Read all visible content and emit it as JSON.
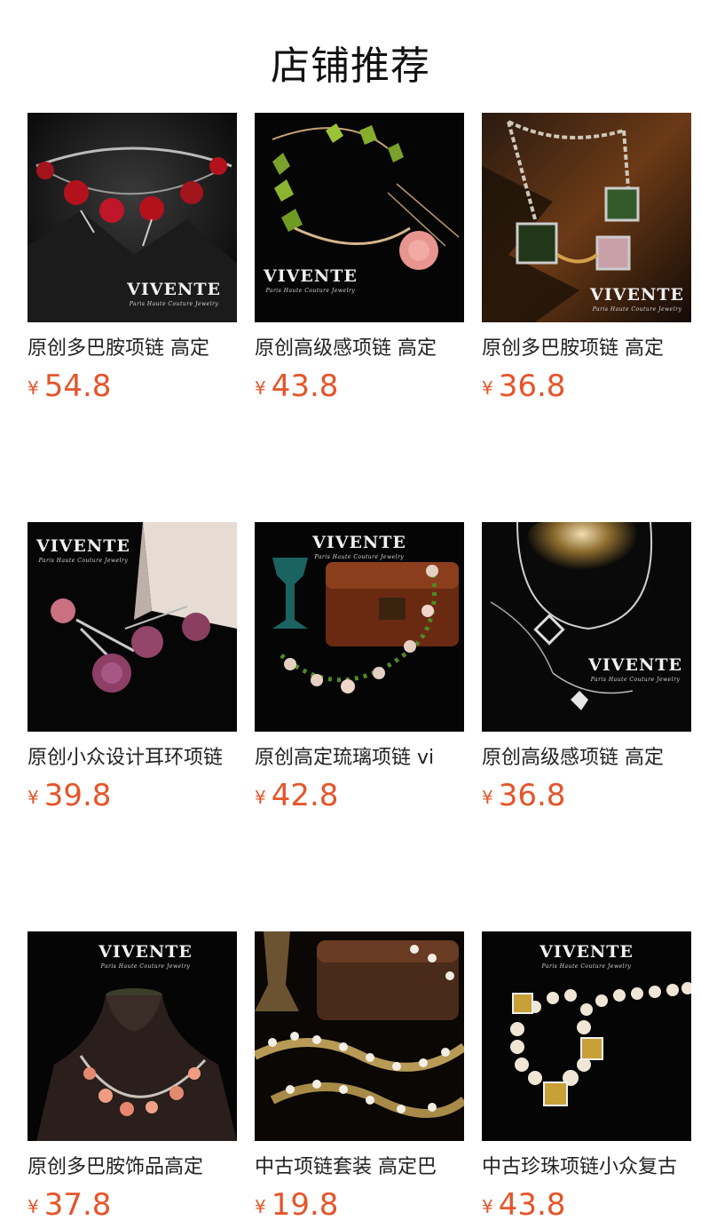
{
  "section_title": "店铺推荐",
  "currency": "¥",
  "brand": {
    "name": "VIVENTE",
    "tagline": "Paris Haute Couture Jewelry"
  },
  "products": [
    {
      "name": "原创多巴胺项链 高定",
      "price": "54.8",
      "image_icon": "rose-choker-image"
    },
    {
      "name": "原创高级感项链 高定",
      "price": "43.8",
      "image_icon": "green-crystal-necklace-image"
    },
    {
      "name": "原创多巴胺项链 高定",
      "price": "36.8",
      "image_icon": "square-gem-chain-image"
    },
    {
      "name": "原创小众设计耳环项链",
      "price": "39.8",
      "image_icon": "purple-rose-earrings-image"
    },
    {
      "name": "原创高定琉璃项链 vi",
      "price": "42.8",
      "image_icon": "glass-bead-necklace-image"
    },
    {
      "name": "原创高级感项链 高定",
      "price": "36.8",
      "image_icon": "silver-pendant-necklace-image"
    },
    {
      "name": "原创多巴胺饰品高定",
      "price": "37.8",
      "image_icon": "pink-stone-necklace-image"
    },
    {
      "name": "中古项链套装 高定巴",
      "price": "19.8",
      "image_icon": "vintage-pearl-set-image"
    },
    {
      "name": "中古珍珠项链小众复古",
      "price": "43.8",
      "image_icon": "pearl-cube-necklace-image"
    }
  ]
}
